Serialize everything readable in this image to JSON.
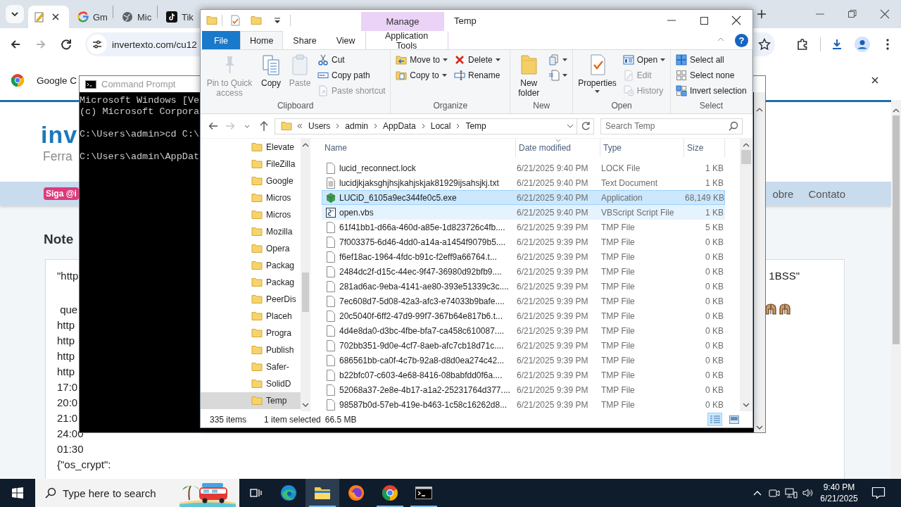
{
  "browser": {
    "tabs": [
      {
        "kind": "notepad",
        "selected": true
      },
      {
        "kind": "google",
        "label": "Gm",
        "selected": false
      },
      {
        "kind": "globe",
        "label": "Mic",
        "selected": false
      },
      {
        "kind": "tiktok",
        "label": "Tik",
        "selected": false
      }
    ],
    "address": "invertexto.com/cu12",
    "infobar": "Google C",
    "page": {
      "logo": "inv",
      "tagline": "Ferra",
      "badge": "Siga @i",
      "nav": [
        "obre",
        "Contato"
      ],
      "heading": "Note",
      "paragraphs": [
        [
          {
            "kind": "text",
            "text": "\"http",
            "end_text": "1BSS\""
          }
        ],
        [
          {
            "kind": "emoji-end",
            "text": " que"
          },
          {
            "kind": "text",
            "text": "http"
          },
          {
            "kind": "text",
            "text": "http"
          },
          {
            "kind": "text",
            "text": "http"
          },
          {
            "kind": "text",
            "text": "http"
          },
          {
            "kind": "text",
            "text": "17:0"
          },
          {
            "kind": "text",
            "text": "20:0"
          },
          {
            "kind": "text",
            "text": "21:0"
          },
          {
            "kind": "text",
            "text": "24:00"
          },
          {
            "kind": "text",
            "text": "01:30"
          },
          {
            "kind": "text",
            "text": "{\"os_crypt\":"
          }
        ]
      ]
    }
  },
  "cmd": {
    "title": "Command Prompt",
    "paragraphs": [
      [
        "Microsoft Windows [Ve",
        "(c) Microsoft Corpora"
      ],
      [
        "C:\\Users\\admin>cd C:\\"
      ],
      [
        "C:\\Users\\admin\\AppDat"
      ]
    ]
  },
  "explorer": {
    "title": "Temp",
    "context_label": "Manage",
    "help": "?",
    "ribbon_tabs": [
      {
        "kind": "file",
        "label": "File",
        "selected": false
      },
      {
        "kind": "normal",
        "label": "Home",
        "selected": true
      },
      {
        "kind": "normal",
        "label": "Share",
        "selected": false
      },
      {
        "kind": "normal",
        "label": "View",
        "selected": false
      },
      {
        "kind": "context",
        "label": "Application Tools",
        "selected": false
      }
    ],
    "ribbon_groups": [
      {
        "label": "Clipboard",
        "items": [
          {
            "kind": "large",
            "label": "Pin to Quick access",
            "disabled": true,
            "menu": false
          },
          {
            "kind": "large",
            "label": "Copy",
            "disabled": false,
            "menu": false
          },
          {
            "kind": "large",
            "label": "Paste",
            "disabled": true,
            "menu": false
          },
          {
            "kind": "column",
            "items": [
              {
                "label": "Cut",
                "disabled": false,
                "menu": false
              },
              {
                "label": "Copy path",
                "disabled": false,
                "menu": false
              },
              {
                "label": "Paste shortcut",
                "disabled": true,
                "menu": false
              }
            ]
          }
        ]
      },
      {
        "label": "Organize",
        "items": [
          {
            "kind": "column",
            "items": [
              {
                "label": "Move to",
                "disabled": false,
                "menu": true
              },
              {
                "label": "Copy to",
                "disabled": false,
                "menu": true
              }
            ]
          },
          {
            "kind": "column",
            "items": [
              {
                "label": "Delete",
                "disabled": false,
                "menu": true
              },
              {
                "label": "Rename",
                "disabled": false,
                "menu": false
              }
            ]
          }
        ]
      },
      {
        "label": "New",
        "items": [
          {
            "kind": "large",
            "label": "New folder",
            "disabled": false,
            "menu": false
          },
          {
            "kind": "column",
            "items": [
              {
                "disabled": false,
                "menu": true
              },
              {
                "disabled": false,
                "menu": true
              }
            ]
          }
        ]
      },
      {
        "label": "Open",
        "items": [
          {
            "kind": "large",
            "label": "Properties",
            "disabled": false,
            "menu": true
          },
          {
            "kind": "column",
            "items": [
              {
                "label": "Open",
                "disabled": false,
                "menu": true
              },
              {
                "label": "Edit",
                "disabled": true,
                "menu": false
              },
              {
                "label": "History",
                "disabled": true,
                "menu": false
              }
            ]
          }
        ]
      },
      {
        "label": "Select",
        "items": [
          {
            "kind": "column",
            "items": [
              {
                "label": "Select all",
                "disabled": false,
                "menu": false
              },
              {
                "label": "Select none",
                "disabled": false,
                "menu": false
              },
              {
                "label": "Invert selection",
                "disabled": false,
                "menu": false
              }
            ]
          }
        ]
      }
    ],
    "path": [
      "Users",
      "admin",
      "AppData",
      "Local",
      "Temp"
    ],
    "search_placeholder": "Search Temp",
    "folders": [
      {
        "label": "Elevate",
        "selected": false
      },
      {
        "label": "FileZilla",
        "selected": false
      },
      {
        "label": "Google",
        "selected": false
      },
      {
        "label": "Micros",
        "selected": false
      },
      {
        "label": "Micros",
        "selected": false
      },
      {
        "label": "Mozilla",
        "selected": false
      },
      {
        "label": "Opera",
        "selected": false
      },
      {
        "label": "Packag",
        "selected": false
      },
      {
        "label": "Packag",
        "selected": false
      },
      {
        "label": "PeerDis",
        "selected": false
      },
      {
        "label": "Placeh",
        "selected": false
      },
      {
        "label": "Progra",
        "selected": false
      },
      {
        "label": "Publish",
        "selected": false
      },
      {
        "label": "Safer-",
        "selected": false
      },
      {
        "label": "SolidD",
        "selected": false
      },
      {
        "label": "Temp",
        "selected": true
      }
    ],
    "columns": [
      {
        "label": "Name",
        "sorted": false
      },
      {
        "label": "Date modified",
        "sorted": true
      },
      {
        "label": "Type",
        "sorted": false
      },
      {
        "label": "Size",
        "sorted": false
      }
    ],
    "files": [
      {
        "kind": "blank",
        "name": "lucid_reconnect.lock",
        "date": "6/21/2025 9:40 PM",
        "type": "LOCK File",
        "size": "1 KB",
        "selected": false,
        "hovered": false
      },
      {
        "kind": "text",
        "name": "lucidjkjaksghjhsjkahjskjak81929ijsahsjkj.txt",
        "date": "6/21/2025 9:40 PM",
        "type": "Text Document",
        "size": "1 KB",
        "selected": false,
        "hovered": false
      },
      {
        "kind": "app",
        "name": "LUCiD_6105a9ec344fe0c5.exe",
        "date": "6/21/2025 9:40 PM",
        "type": "Application",
        "size": "68,149 KB",
        "selected": true,
        "hovered": false
      },
      {
        "kind": "script",
        "name": "open.vbs",
        "date": "6/21/2025 9:40 PM",
        "type": "VBScript Script File",
        "size": "1 KB",
        "selected": false,
        "hovered": true
      },
      {
        "kind": "blank",
        "name": "61f41bb1-d66a-460d-a85e-1d823726c4fb....",
        "date": "6/21/2025 9:39 PM",
        "type": "TMP File",
        "size": "5 KB",
        "selected": false,
        "hovered": false
      },
      {
        "kind": "blank",
        "name": "7f003375-6d46-4dd0-a14a-a1454f9079b5....",
        "date": "6/21/2025 9:39 PM",
        "type": "TMP File",
        "size": "0 KB",
        "selected": false,
        "hovered": false
      },
      {
        "kind": "blank",
        "name": "f6ef18ac-1964-4fdc-b91c-f2eff9a66764.t...",
        "date": "6/21/2025 9:39 PM",
        "type": "TMP File",
        "size": "0 KB",
        "selected": false,
        "hovered": false
      },
      {
        "kind": "blank",
        "name": "2484dc2f-d15c-44ec-9f47-36980d92bfb9....",
        "date": "6/21/2025 9:39 PM",
        "type": "TMP File",
        "size": "0 KB",
        "selected": false,
        "hovered": false
      },
      {
        "kind": "blank",
        "name": "281ad6ac-9eba-4141-ae80-393e51339c3c....",
        "date": "6/21/2025 9:39 PM",
        "type": "TMP File",
        "size": "0 KB",
        "selected": false,
        "hovered": false
      },
      {
        "kind": "blank",
        "name": "7ec608d7-5d08-42a3-afc3-e74033b9bafe....",
        "date": "6/21/2025 9:39 PM",
        "type": "TMP File",
        "size": "0 KB",
        "selected": false,
        "hovered": false
      },
      {
        "kind": "blank",
        "name": "20c5040f-6ff2-47d9-99f7-367b64e817b6.t...",
        "date": "6/21/2025 9:39 PM",
        "type": "TMP File",
        "size": "0 KB",
        "selected": false,
        "hovered": false
      },
      {
        "kind": "blank",
        "name": "4d4e8da0-d3bc-4fbe-bfa7-ca458c610087....",
        "date": "6/21/2025 9:39 PM",
        "type": "TMP File",
        "size": "0 KB",
        "selected": false,
        "hovered": false
      },
      {
        "kind": "blank",
        "name": "702bb351-9d0e-4cf7-8aeb-afc7cb18d71c....",
        "date": "6/21/2025 9:39 PM",
        "type": "TMP File",
        "size": "0 KB",
        "selected": false,
        "hovered": false
      },
      {
        "kind": "blank",
        "name": "686561bb-ca0f-4c7b-92a8-d8d0ea274c42...",
        "date": "6/21/2025 9:39 PM",
        "type": "TMP File",
        "size": "0 KB",
        "selected": false,
        "hovered": false
      },
      {
        "kind": "blank",
        "name": "b22bfc07-c603-4e68-8416-08babfdd0f6a....",
        "date": "6/21/2025 9:39 PM",
        "type": "TMP File",
        "size": "0 KB",
        "selected": false,
        "hovered": false
      },
      {
        "kind": "blank",
        "name": "52068a37-2e8e-4b17-a1a2-25231764d377....",
        "date": "6/21/2025 9:39 PM",
        "type": "TMP File",
        "size": "0 KB",
        "selected": false,
        "hovered": false
      },
      {
        "kind": "blank",
        "name": "98587b0d-57eb-419e-b463-1c58c16262d8...",
        "date": "6/21/2025 9:39 PM",
        "type": "TMP File",
        "size": "0 KB",
        "selected": false,
        "hovered": false
      }
    ],
    "status": {
      "count": "335 items",
      "selection": "1 item selected",
      "size": "66.5 MB"
    },
    "views": [
      {
        "kind": "details",
        "selected": true
      },
      {
        "kind": "large-icons",
        "selected": false
      }
    ]
  },
  "taskbar": {
    "search_placeholder": "Type here to search",
    "apps": [
      {
        "kind": "task-view",
        "active": false,
        "running": false
      },
      {
        "kind": "edge",
        "active": false,
        "running": false
      },
      {
        "kind": "explorer",
        "active": true,
        "running": true
      },
      {
        "kind": "firefox",
        "active": false,
        "running": false
      },
      {
        "kind": "chrome",
        "active": false,
        "running": true
      },
      {
        "kind": "terminal",
        "active": false,
        "running": true
      }
    ],
    "time": "9:40 PM",
    "date": "6/21/2025"
  }
}
